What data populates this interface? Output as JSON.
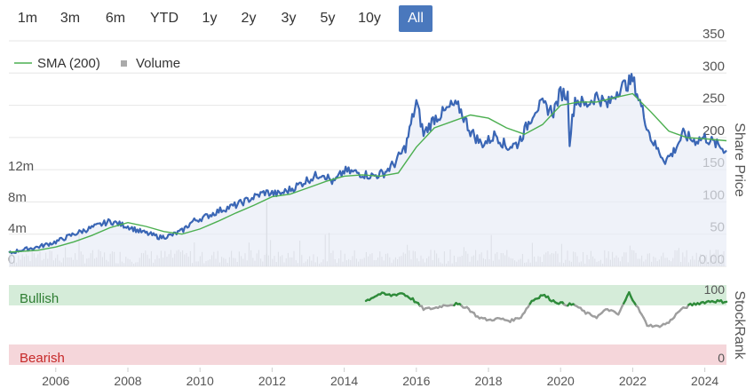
{
  "range_selector": {
    "buttons": [
      "1m",
      "3m",
      "6m",
      "YTD",
      "1y",
      "2y",
      "3y",
      "5y",
      "10y",
      "All"
    ],
    "active": "All"
  },
  "legend": {
    "sma_label": "SMA (200)",
    "volume_label": "Volume",
    "sma_color": "#4caf50",
    "volume_color": "#aaaaaa"
  },
  "colors": {
    "price_line": "#3a66b5",
    "bullish_band": "#d5ecd9",
    "bearish_band": "#f5d6da",
    "bullish_line": "#2e8b3a",
    "neutral_line": "#9e9e9e"
  },
  "chart_data": [
    {
      "type": "line",
      "ylabel": "Share Price",
      "ylim": [
        0,
        350
      ],
      "yticks": [
        "0.00",
        "50",
        "100",
        "150",
        "200",
        "250",
        "300",
        "350"
      ],
      "volume_ticks": [
        "0",
        "4m",
        "8m",
        "12m"
      ],
      "volume_ylim": [
        0,
        16
      ],
      "xlim": [
        2004.7,
        2024.6
      ],
      "xticks": [
        "2006",
        "2008",
        "2010",
        "2012",
        "2014",
        "2016",
        "2018",
        "2020",
        "2022",
        "2024"
      ],
      "series": [
        {
          "name": "Share Price",
          "x": [
            2004.7,
            2005.0,
            2005.5,
            2006.0,
            2006.5,
            2007.0,
            2007.5,
            2008.0,
            2008.3,
            2008.6,
            2008.9,
            2009.2,
            2009.5,
            2009.8,
            2010.2,
            2010.6,
            2011.0,
            2011.4,
            2011.8,
            2012.2,
            2012.6,
            2013.0,
            2013.4,
            2013.7,
            2014.0,
            2014.4,
            2014.8,
            2015.1,
            2015.4,
            2015.7,
            2016.0,
            2016.2,
            2016.5,
            2016.8,
            2017.0,
            2017.2,
            2017.5,
            2017.8,
            2018.0,
            2018.2,
            2018.5,
            2018.8,
            2019.0,
            2019.3,
            2019.5,
            2019.8,
            2020.0,
            2020.2,
            2020.25,
            2020.4,
            2020.7,
            2021.0,
            2021.3,
            2021.6,
            2021.9,
            2022.0,
            2022.2,
            2022.5,
            2022.7,
            2022.9,
            2023.1,
            2023.4,
            2023.7,
            2024.0,
            2024.3,
            2024.6
          ],
          "y": [
            20,
            25,
            30,
            38,
            50,
            60,
            70,
            62,
            55,
            50,
            45,
            48,
            55,
            70,
            78,
            88,
            95,
            105,
            115,
            112,
            122,
            135,
            145,
            130,
            148,
            145,
            140,
            145,
            160,
            185,
            255,
            205,
            230,
            240,
            250,
            245,
            210,
            190,
            195,
            205,
            185,
            190,
            210,
            245,
            250,
            240,
            270,
            265,
            195,
            260,
            250,
            265,
            250,
            275,
            285,
            290,
            255,
            200,
            180,
            165,
            175,
            205,
            195,
            200,
            190,
            180
          ]
        },
        {
          "name": "SMA (200)",
          "x": [
            2004.7,
            2005.5,
            2006.0,
            2006.5,
            2007.0,
            2007.5,
            2008.0,
            2008.5,
            2009.0,
            2009.5,
            2010.0,
            2010.5,
            2011.0,
            2011.5,
            2012.0,
            2012.5,
            2013.0,
            2013.5,
            2014.0,
            2014.5,
            2015.0,
            2015.5,
            2016.0,
            2016.5,
            2017.0,
            2017.5,
            2018.0,
            2018.5,
            2019.0,
            2019.5,
            2020.0,
            2020.5,
            2021.0,
            2021.5,
            2022.0,
            2022.5,
            2023.0,
            2023.5,
            2024.0,
            2024.6
          ],
          "y": [
            22,
            25,
            30,
            38,
            48,
            60,
            68,
            62,
            54,
            50,
            58,
            70,
            83,
            95,
            108,
            112,
            122,
            132,
            140,
            142,
            140,
            145,
            185,
            215,
            225,
            235,
            230,
            215,
            205,
            220,
            250,
            255,
            255,
            262,
            268,
            240,
            210,
            200,
            198,
            195
          ]
        }
      ]
    },
    {
      "type": "line",
      "ylabel": "StockRank",
      "ylim": [
        0,
        100
      ],
      "yticks": [
        "0",
        "100"
      ],
      "band_labels": {
        "bullish": "Bullish",
        "bearish": "Bearish"
      },
      "series": [
        {
          "name": "StockRank",
          "x": [
            2014.6,
            2014.8,
            2015.0,
            2015.3,
            2015.6,
            2015.9,
            2016.2,
            2016.5,
            2016.8,
            2017.1,
            2017.4,
            2017.7,
            2018.0,
            2018.3,
            2018.6,
            2018.9,
            2019.2,
            2019.5,
            2019.8,
            2020.1,
            2020.4,
            2020.7,
            2021.0,
            2021.3,
            2021.6,
            2021.9,
            2022.1,
            2022.4,
            2022.7,
            2023.0,
            2023.3,
            2023.6,
            2023.9,
            2024.2,
            2024.6
          ],
          "y": [
            80,
            85,
            89,
            87,
            90,
            82,
            70,
            71,
            75,
            76,
            72,
            60,
            56,
            58,
            55,
            60,
            80,
            88,
            80,
            76,
            75,
            65,
            60,
            70,
            63,
            90,
            75,
            50,
            48,
            53,
            68,
            75,
            78,
            80,
            79
          ]
        }
      ]
    }
  ]
}
